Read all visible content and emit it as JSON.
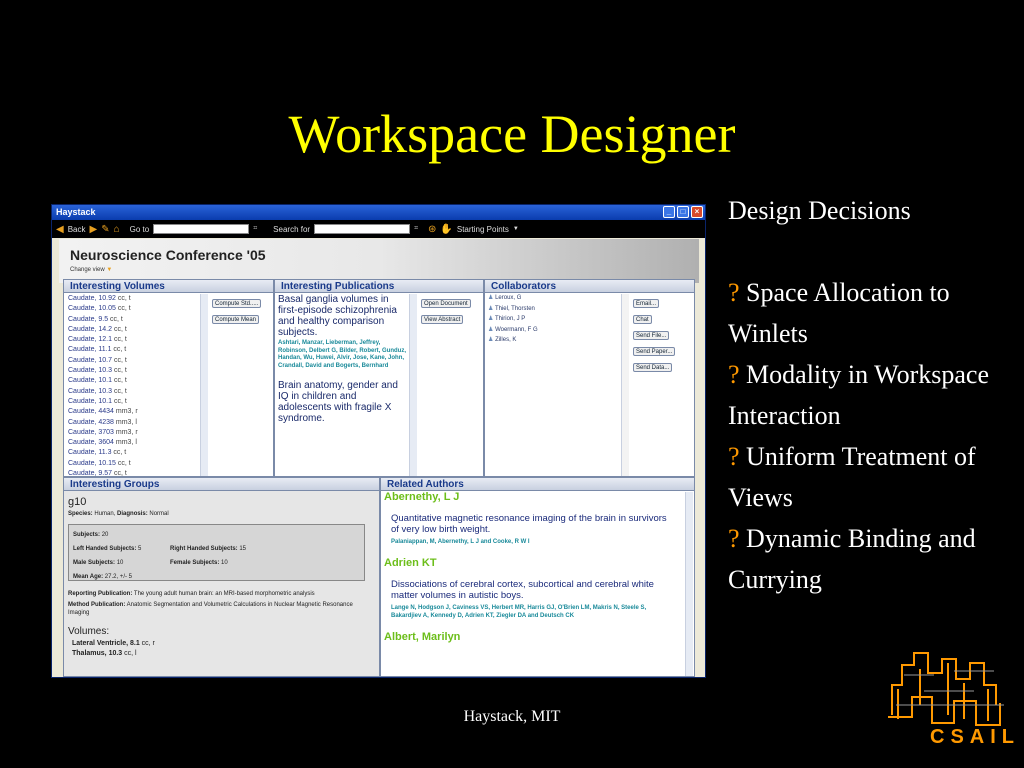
{
  "slide": {
    "title": "Workspace Designer",
    "footer": "Haystack, MIT",
    "logo_text": "CSAIL",
    "right_heading": "Design Decisions",
    "bullet_mark": "?",
    "bullets": [
      "Space Allocation to Winlets",
      "Modality in Workspace Interaction",
      "Uniform Treatment of Views",
      "Dynamic Binding and Currying"
    ]
  },
  "window": {
    "title": "Haystack",
    "toolbar": {
      "back": "Back",
      "goto": "Go to",
      "search": "Search for",
      "starting_points": "Starting Points"
    },
    "banner_title": "Neuroscience Conference '05",
    "change_view": "Change view"
  },
  "volumes": {
    "header": "Interesting Volumes",
    "rows": [
      [
        "Caudate, 10.92",
        "cc, t"
      ],
      [
        "Caudate, 10.05",
        "cc, t"
      ],
      [
        "Caudate, 9.5",
        "cc, t"
      ],
      [
        "Caudate, 14.2",
        "cc, t"
      ],
      [
        "Caudate, 12.1",
        "cc, t"
      ],
      [
        "Caudate, 11.1",
        "cc, t"
      ],
      [
        "Caudate, 10.7",
        "cc, t"
      ],
      [
        "Caudate, 10.3",
        "cc, t"
      ],
      [
        "Caudate, 10.1",
        "cc, t"
      ],
      [
        "Caudate, 10.3",
        "cc, t"
      ],
      [
        "Caudate, 10.1",
        "cc, t"
      ],
      [
        "Caudate, 4434",
        "mm3, r"
      ],
      [
        "Caudate, 4238",
        "mm3, l"
      ],
      [
        "Caudate, 3703",
        "mm3, r"
      ],
      [
        "Caudate, 3604",
        "mm3, l"
      ],
      [
        "Caudate, 11.3",
        "cc, t"
      ],
      [
        "Caudate, 10.15",
        "cc, t"
      ],
      [
        "Caudate, 9.57",
        "cc, t"
      ]
    ],
    "btn_compute_std": "Compute Std.....",
    "btn_compute_mean": "Compute Mean"
  },
  "publications": {
    "header": "Interesting Publications",
    "pub1_title": "Basal ganglia volumes in first-episode schizophrenia and healthy comparison subjects.",
    "pub1_authors": "Ashtari, Manzar, Lieberman, Jeffrey, Robinson, Delbert G, Bilder, Robert, Gunduz, Handan, Wu, Huwei, Alvir, Jose, Kane, John, Crandall, David and Bogerts, Bernhard",
    "pub2_title": "Brain anatomy, gender and IQ in children and adolescents with fragile X syndrome.",
    "btn_open": "Open Document",
    "btn_view": "View Abstract"
  },
  "collaborators": {
    "header": "Collaborators",
    "names": [
      "Leroux, G",
      "Thiel, Thorsten",
      "Thirion, J P",
      "Woermann, F G",
      "Zilles, K"
    ],
    "buttons": [
      "Email...",
      "Chat",
      "Send File...",
      "Send Paper...",
      "Send Data..."
    ]
  },
  "groups": {
    "header": "Interesting Groups",
    "name": "g10",
    "species_label": "Species:",
    "species": "Human,",
    "diagnosis_label": "Diagnosis:",
    "diagnosis": "Normal",
    "subjects_label": "Subjects:",
    "subjects": "20",
    "lh_label": "Left Handed Subjects:",
    "lh": "5",
    "rh_label": "Right Handed Subjects:",
    "rh": "15",
    "male_label": "Male Subjects:",
    "male": "10",
    "female_label": "Female Subjects:",
    "female": "10",
    "age_label": "Mean Age:",
    "age": "27.2, +/- 5",
    "rep_label": "Reporting Publication:",
    "rep": "The young adult human brain: an MRI-based morphometric analysis",
    "meth_label": "Method Publication:",
    "meth": "Anatomic Segmentation and Volumetric Calculations in Nuclear Magnetic Resonance Imaging",
    "volumes_label": "Volumes:",
    "vol1_name": "Lateral Ventricle,",
    "vol1_val": "8.1",
    "vol1_unit": "cc, r",
    "vol2_name": "Thalamus,",
    "vol2_val": "10.3",
    "vol2_unit": "cc, l"
  },
  "authors": {
    "header": "Related Authors",
    "a1_name": "Abernethy, L J",
    "a1_title": "Quantitative magnetic resonance imaging of the brain in survivors of very low birth weight.",
    "a1_authors": "Palaniappan, M, Abernethy, L J and Cooke, R W I",
    "a2_name": "Adrien KT",
    "a2_title": "Dissociations of cerebral cortex, subcortical and cerebral white matter volumes in autistic boys.",
    "a2_authors": "Lange N, Hodgson J, Caviness VS, Herbert MR, Harris GJ, O'Brien LM, Makris N, Steele S, Bakardjiev A, Kennedy D, Adrien KT, Ziegler DA and Deutsch CK",
    "a3_name": "Albert, Marilyn"
  },
  "colors": {
    "title": "#ffff00",
    "bullet": "#ff9900",
    "accent_green": "#6cbe1a",
    "link_teal": "#1a8a9a"
  }
}
